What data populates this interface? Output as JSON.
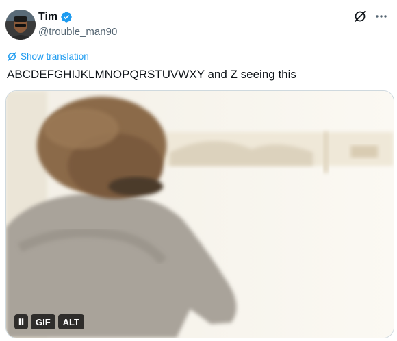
{
  "author": {
    "name": "Tim",
    "handle": "@trouble_man90",
    "verified": true,
    "verified_color": "#1d9bf0"
  },
  "actions": {
    "grok_icon": "grok-icon",
    "more_icon": "more-icon"
  },
  "translation": {
    "label": "Show translation",
    "icon": "translate-icon"
  },
  "tweet": {
    "text": "ABCDEFGHIJKLMNOPQRSTUVWXY and Z seeing this"
  },
  "media": {
    "type": "gif",
    "controls": {
      "pause_icon": "pause-icon",
      "gif_label": "GIF",
      "alt_label": "ALT"
    }
  },
  "colors": {
    "text_primary": "#0f1419",
    "text_secondary": "#536471",
    "link": "#1d9bf0",
    "border": "#cfd9de"
  }
}
